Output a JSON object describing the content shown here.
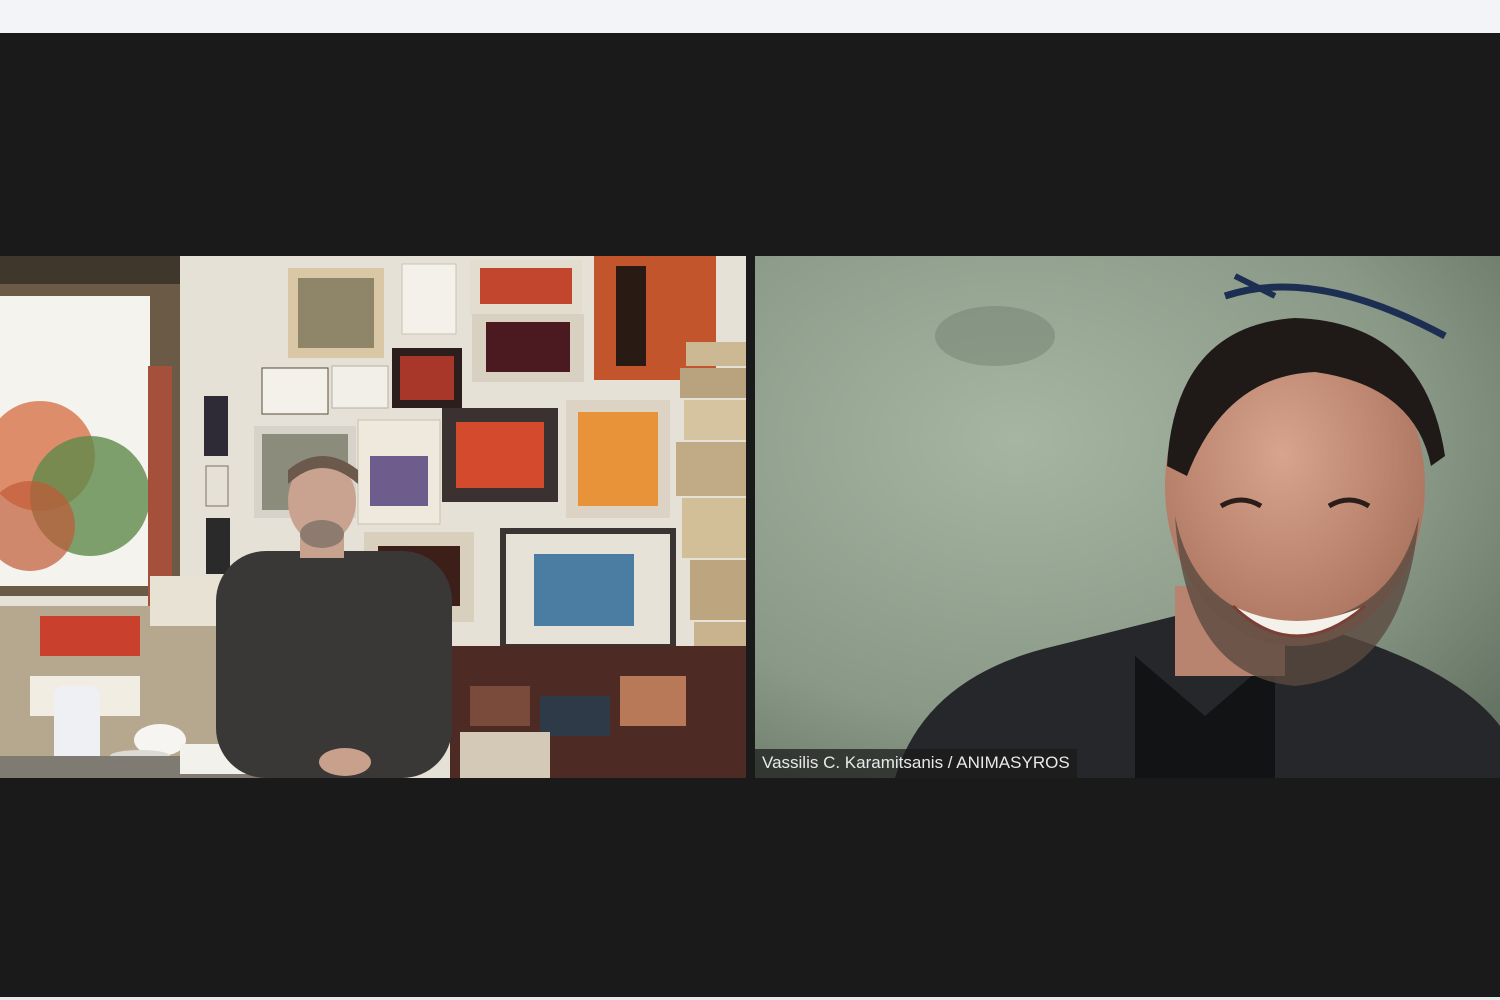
{
  "meeting": {
    "participants": [
      {
        "id": "participant-1",
        "name": "",
        "video": "on"
      },
      {
        "id": "participant-2",
        "name": "Vassilis C. Karamitsanis / ANIMASYROS",
        "video": "on"
      }
    ]
  },
  "colors": {
    "stage_background": "#1a1a1a",
    "chrome_background": "#f3f4f8",
    "label_text": "#e9e9e9"
  }
}
